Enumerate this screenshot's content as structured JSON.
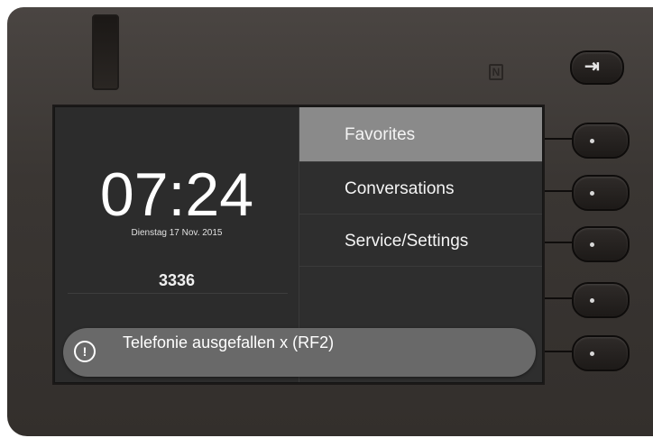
{
  "screen": {
    "time": "07:24",
    "date": "Dienstag 17 Nov. 2015",
    "extension": "3336"
  },
  "menu": {
    "items": [
      {
        "label": "Favorites",
        "selected": true
      },
      {
        "label": "Conversations",
        "selected": false
      },
      {
        "label": "Service/Settings",
        "selected": false
      }
    ]
  },
  "notification": {
    "icon": "alert-circle-icon",
    "text": "Telefonie ausgefallen x (RF2)"
  },
  "hardware": {
    "nfc_glyph": "N",
    "logout_icon": "logout-icon"
  },
  "colors": {
    "menu_selected": "#8a8a8a",
    "screen_bg": "#2c2c2c",
    "toast_bg": "#696969"
  }
}
